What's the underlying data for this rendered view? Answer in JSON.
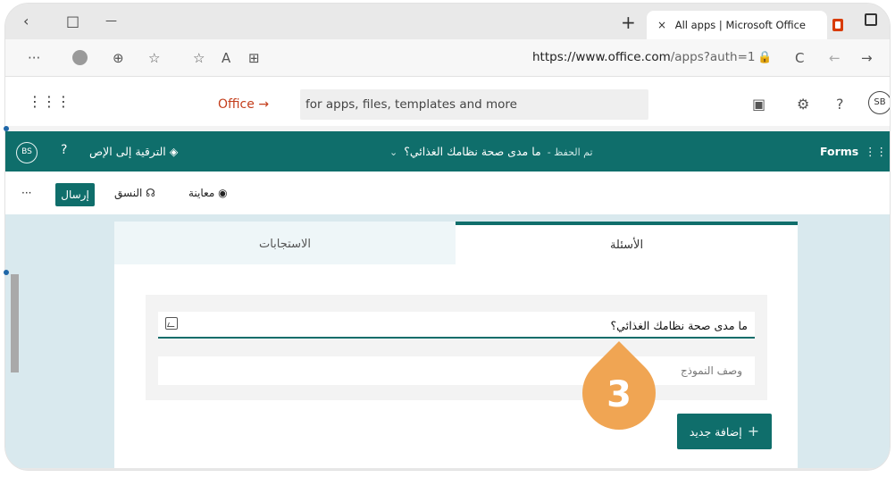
{
  "browser": {
    "tab_title": "All apps | Microsoft Office",
    "tab_close": "×",
    "new_tab": "+",
    "url_host": "https://www.office.com",
    "url_path": "/apps?auth=1",
    "controls": {
      "back": "‹",
      "restore": "□",
      "minimize": "—",
      "more": "···",
      "collections": "⊕",
      "favorites": "☆",
      "reading": "A",
      "split": "⊞",
      "refresh": "C",
      "nav_back": "←",
      "nav_forward": "→",
      "lock": "🔒"
    }
  },
  "office_header": {
    "app_launcher": "⋮⋮⋮",
    "office_link": "Office →",
    "search_placeholder": "for apps, files, templates and more",
    "help": "?",
    "settings": "⚙",
    "user_initials": "SB"
  },
  "forms_bar": {
    "app_name": "Forms",
    "launcher": "⋮⋮⋮",
    "form_title": "ما مدى صحة نظامك الغذائي؟",
    "saved_status": "تم الحفظ",
    "upgrade": "الترقية إلى الإص",
    "help": "?",
    "user_initials": "BS"
  },
  "toolbar": {
    "send": "إرسال",
    "theme": "النسق",
    "preview": "معاينة",
    "more": "···"
  },
  "tabs": {
    "questions": "الأسئلة",
    "responses": "الاستجابات"
  },
  "form": {
    "title_value": "ما مدى صحة نظامك الغذائي؟",
    "description_placeholder": "وصف النموذج",
    "add_new": "إضافة جديد",
    "add_plus": "+"
  },
  "annotation": {
    "step_number": "3",
    "color": "#f0a553"
  },
  "colors": {
    "teal": "#0f6e6b",
    "office_orange": "#c43e1c",
    "canvas": "#d9e9ee"
  }
}
